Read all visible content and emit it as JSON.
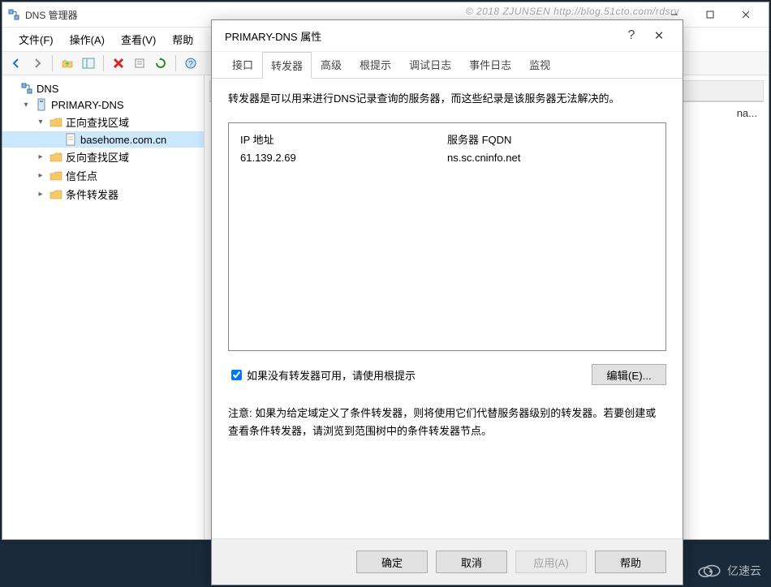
{
  "watermark": "© 2018 ZJUNSEN http://blog.51cto.com/rdsrv",
  "main_window": {
    "title": "DNS 管理器",
    "menus": [
      "文件(F)",
      "操作(A)",
      "查看(V)",
      "帮助"
    ],
    "content_header_truncated": "na..."
  },
  "tree": {
    "root": "DNS",
    "server": "PRIMARY-DNS",
    "forward": "正向查找区域",
    "zone": "basehome.com.cn",
    "reverse": "反向查找区域",
    "trust": "信任点",
    "cond": "条件转发器"
  },
  "dialog": {
    "title": "PRIMARY-DNS 属性",
    "tabs": [
      "接口",
      "转发器",
      "高级",
      "根提示",
      "调试日志",
      "事件日志",
      "监视"
    ],
    "active_tab": 1,
    "description": "转发器是可以用来进行DNS记录查询的服务器，而这些纪录是该服务器无法解决的。",
    "columns": {
      "ip": "IP 地址",
      "fqdn": "服务器 FQDN"
    },
    "rows": [
      {
        "ip": "61.139.2.69",
        "fqdn": "ns.sc.cninfo.net"
      }
    ],
    "checkbox_label": "如果没有转发器可用，请使用根提示",
    "checkbox_checked": true,
    "edit_button": "编辑(E)...",
    "note": "注意: 如果为给定域定义了条件转发器，则将使用它们代替服务器级别的转发器。若要创建或查看条件转发器，请浏览到范围树中的条件转发器节点。",
    "buttons": {
      "ok": "确定",
      "cancel": "取消",
      "apply": "应用(A)",
      "help": "帮助"
    }
  },
  "brand": "亿速云"
}
